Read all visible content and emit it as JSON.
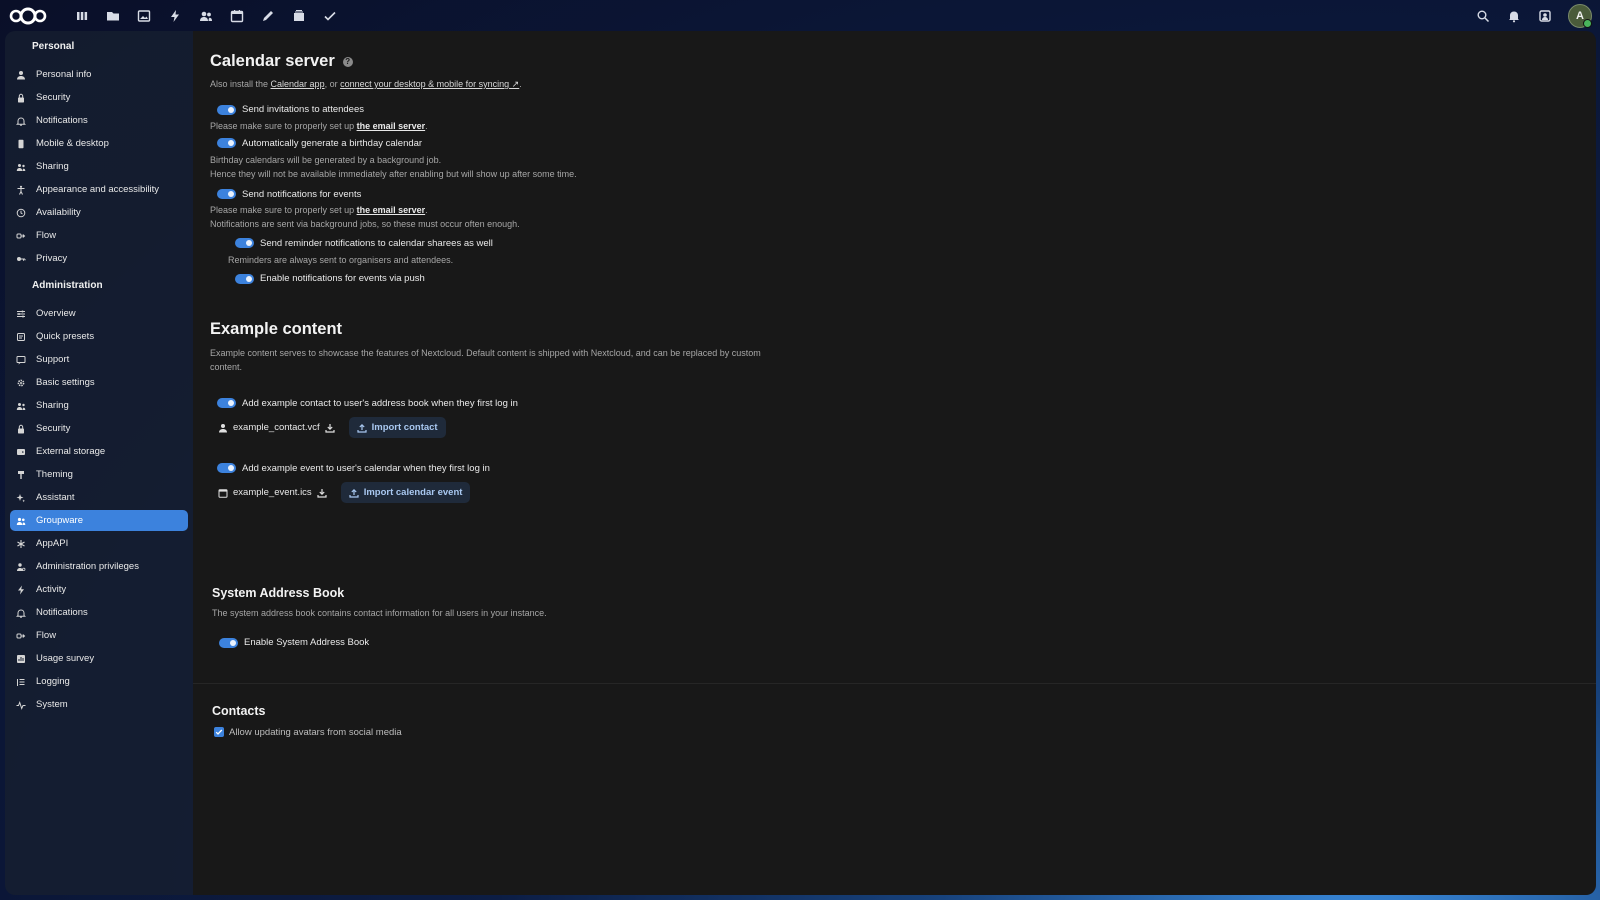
{
  "topbar": {
    "apps": [
      {
        "icon": "dashboard-icon"
      },
      {
        "icon": "files-icon"
      },
      {
        "icon": "photos-icon"
      },
      {
        "icon": "activity-icon"
      },
      {
        "icon": "contacts-icon"
      },
      {
        "icon": "calendar-icon"
      },
      {
        "icon": "notes-icon"
      },
      {
        "icon": "deck-icon"
      },
      {
        "icon": "tasks-icon"
      }
    ],
    "avatar_letter": "A"
  },
  "sidebar": {
    "personal_heading": "Personal",
    "personal_items": [
      {
        "label": "Personal info",
        "icon": "user-icon"
      },
      {
        "label": "Security",
        "icon": "lock-icon"
      },
      {
        "label": "Notifications",
        "icon": "bell-icon"
      },
      {
        "label": "Mobile & desktop",
        "icon": "phone-icon"
      },
      {
        "label": "Sharing",
        "icon": "share-icon"
      },
      {
        "label": "Appearance and accessibility",
        "icon": "accessibility-icon"
      },
      {
        "label": "Availability",
        "icon": "clock-icon"
      },
      {
        "label": "Flow",
        "icon": "flow-icon"
      },
      {
        "label": "Privacy",
        "icon": "key-icon"
      }
    ],
    "admin_heading": "Administration",
    "admin_items": [
      {
        "label": "Overview",
        "icon": "sliders-icon",
        "active": false
      },
      {
        "label": "Quick presets",
        "icon": "presets-icon",
        "active": false
      },
      {
        "label": "Support",
        "icon": "support-icon",
        "active": false
      },
      {
        "label": "Basic settings",
        "icon": "gear-icon",
        "active": false
      },
      {
        "label": "Sharing",
        "icon": "share-icon",
        "active": false
      },
      {
        "label": "Security",
        "icon": "lock-icon",
        "active": false
      },
      {
        "label": "External storage",
        "icon": "storage-icon",
        "active": false
      },
      {
        "label": "Theming",
        "icon": "brush-icon",
        "active": false
      },
      {
        "label": "Assistant",
        "icon": "sparkle-icon",
        "active": false
      },
      {
        "label": "Groupware",
        "icon": "group-icon",
        "active": true
      },
      {
        "label": "AppAPI",
        "icon": "api-icon",
        "active": false
      },
      {
        "label": "Administration privileges",
        "icon": "admin-icon",
        "active": false
      },
      {
        "label": "Activity",
        "icon": "bolt-icon",
        "active": false
      },
      {
        "label": "Notifications",
        "icon": "bell-icon",
        "active": false
      },
      {
        "label": "Flow",
        "icon": "flow-icon",
        "active": false
      },
      {
        "label": "Usage survey",
        "icon": "chart-icon",
        "active": false
      },
      {
        "label": "Logging",
        "icon": "list-icon",
        "active": false
      },
      {
        "label": "System",
        "icon": "pulse-icon",
        "active": false
      }
    ]
  },
  "calendar": {
    "title": "Calendar server",
    "intro_prefix": "Also install the ",
    "intro_link1": "Calendar app",
    "intro_mid": ", or ",
    "intro_link2": "connect your desktop & mobile for syncing ↗",
    "intro_suffix": ".",
    "toggle_invitations": "Send invitations to attendees",
    "email_note_prefix": "Please make sure to properly set up ",
    "email_link": "the email server",
    "email_note_suffix": ".",
    "toggle_birthday": "Automatically generate a birthday calendar",
    "birthday_note1": "Birthday calendars will be generated by a background job.",
    "birthday_note2": "Hence they will not be available immediately after enabling but will show up after some time.",
    "toggle_notifications": "Send notifications for events",
    "notif_note_prefix": "Please make sure to properly set up ",
    "notif_note_link": "the email server",
    "notif_note_suffix": ".",
    "notif_note2": "Notifications are sent via background jobs, so these must occur often enough.",
    "toggle_reminders": "Send reminder notifications to calendar sharees as well",
    "reminders_note": "Reminders are always sent to organisers and attendees.",
    "toggle_push": "Enable notifications for events via push"
  },
  "example": {
    "title": "Example content",
    "desc": "Example content serves to showcase the features of Nextcloud. Default content is shipped with Nextcloud, and can be replaced by custom content.",
    "toggle_contact": "Add example contact to user's address book when they first log in",
    "contact_file": "example_contact.vcf",
    "import_contact": "Import contact",
    "toggle_event": "Add example event to user's calendar when they first log in",
    "event_file": "example_event.ics",
    "import_event": "Import calendar event"
  },
  "address_book": {
    "title": "System Address Book",
    "desc": "The system address book contains contact information for all users in your instance.",
    "toggle": "Enable System Address Book"
  },
  "contacts": {
    "title": "Contacts",
    "checkbox_label": "Allow updating avatars from social media"
  },
  "colors": {
    "accent": "#3c82dd",
    "content_bg": "#181818",
    "sidebar_bg": "#161e30"
  }
}
